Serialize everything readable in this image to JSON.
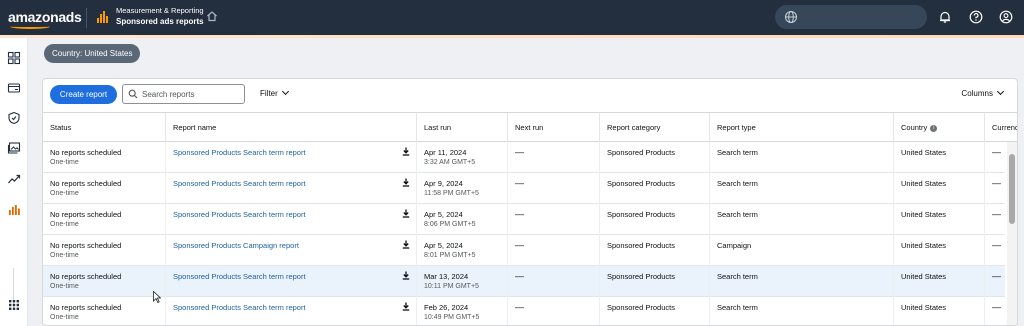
{
  "header": {
    "logo": "amazonads",
    "breadcrumb_parent": "Measurement & Reporting",
    "breadcrumb_current": "Sponsored ads reports"
  },
  "country_chip": "Country: United States",
  "toolbar": {
    "create_label": "Create report",
    "search_placeholder": "Search reports",
    "filter_label": "Filter",
    "columns_label": "Columns"
  },
  "columns": [
    "Status",
    "Report name",
    "Last run",
    "Next run",
    "Report category",
    "Report type",
    "Country",
    "Currenc"
  ],
  "rows": [
    {
      "status": "No reports scheduled",
      "frequency": "One-time",
      "name": "Sponsored Products Search term report",
      "last_run_date": "Apr 11, 2024",
      "last_run_time": "3:32 AM GMT+5",
      "next_run": "—",
      "category": "Sponsored Products",
      "type": "Search term",
      "country": "United States",
      "currency": "—"
    },
    {
      "status": "No reports scheduled",
      "frequency": "One-time",
      "name": "Sponsored Products Search term report",
      "last_run_date": "Apr 9, 2024",
      "last_run_time": "11:58 PM GMT+5",
      "next_run": "—",
      "category": "Sponsored Products",
      "type": "Search term",
      "country": "United States",
      "currency": "—"
    },
    {
      "status": "No reports scheduled",
      "frequency": "One-time",
      "name": "Sponsored Products Search term report",
      "last_run_date": "Apr 5, 2024",
      "last_run_time": "8:06 PM GMT+5",
      "next_run": "—",
      "category": "Sponsored Products",
      "type": "Search term",
      "country": "United States",
      "currency": "—"
    },
    {
      "status": "No reports scheduled",
      "frequency": "One-time",
      "name": "Sponsored Products Campaign report",
      "last_run_date": "Apr 5, 2024",
      "last_run_time": "8:01 PM GMT+5",
      "next_run": "—",
      "category": "Sponsored Products",
      "type": "Campaign",
      "country": "United States",
      "currency": "—"
    },
    {
      "status": "No reports scheduled",
      "frequency": "One-time",
      "name": "Sponsored Products Search term report",
      "last_run_date": "Mar 13, 2024",
      "last_run_time": "10:11 PM GMT+5",
      "next_run": "—",
      "category": "Sponsored Products",
      "type": "Search term",
      "country": "United States",
      "currency": "—"
    },
    {
      "status": "No reports scheduled",
      "frequency": "One-time",
      "name": "Sponsored Products Search term report",
      "last_run_date": "Feb 26, 2024",
      "last_run_time": "10:49 PM GMT+5",
      "next_run": "—",
      "category": "Sponsored Products",
      "type": "Search term",
      "country": "United States",
      "currency": "—"
    }
  ],
  "colors": {
    "topbar": "#232f3e",
    "primary": "#1f6ee0",
    "link": "#2162a1",
    "accent": "#ff9900"
  },
  "icons": [
    "globe-icon",
    "bell-icon",
    "help-icon",
    "user-icon",
    "home-icon",
    "search-icon",
    "download-icon",
    "info-icon",
    "apps-grid-icon"
  ]
}
